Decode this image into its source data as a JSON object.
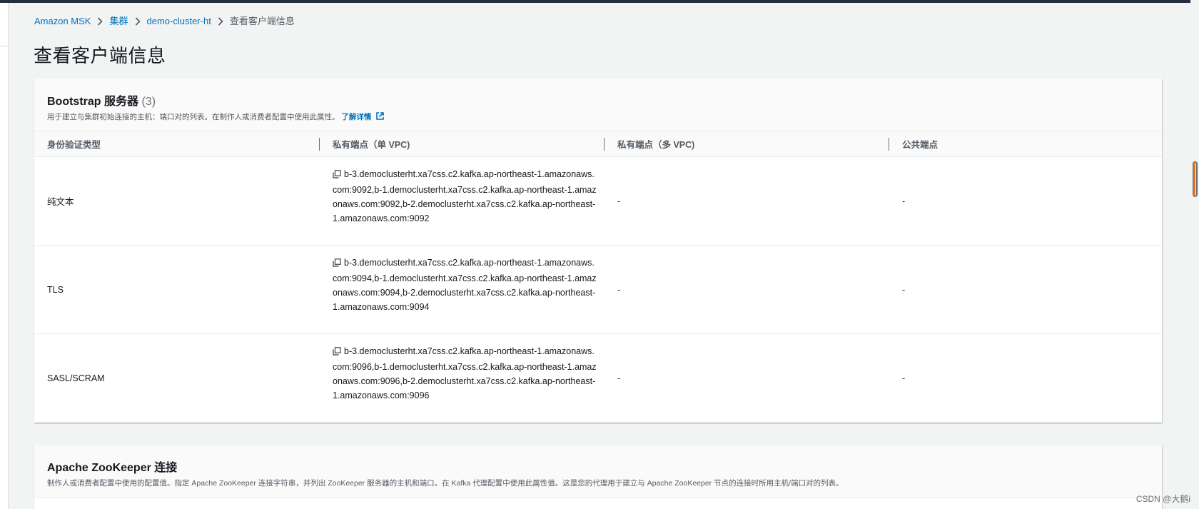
{
  "breadcrumb": {
    "items": [
      "Amazon MSK",
      "集群",
      "demo-cluster-ht"
    ],
    "current": "查看客户端信息"
  },
  "page_title": "查看客户端信息",
  "bootstrap": {
    "title": "Bootstrap 服务器",
    "count": "(3)",
    "description": "用于建立与集群初始连接的主机：端口对的列表。在制作人或消费者配置中使用此属性。",
    "learn_more": "了解详情",
    "columns": [
      "身份验证类型",
      "私有端点（单 VPC)",
      "私有端点（多 VPC)",
      "公共端点"
    ],
    "rows": [
      {
        "auth": "纯文本",
        "single_vpc": "b-3.democlusterht.xa7css.c2.kafka.ap-northeast-1.amazonaws.com:9092,b-1.democlusterht.xa7css.c2.kafka.ap-northeast-1.amazonaws.com:9092,b-2.democlusterht.xa7css.c2.kafka.ap-northeast-1.amazonaws.com:9092",
        "multi_vpc": "-",
        "public": "-"
      },
      {
        "auth": "TLS",
        "single_vpc": "b-3.democlusterht.xa7css.c2.kafka.ap-northeast-1.amazonaws.com:9094,b-1.democlusterht.xa7css.c2.kafka.ap-northeast-1.amazonaws.com:9094,b-2.democlusterht.xa7css.c2.kafka.ap-northeast-1.amazonaws.com:9094",
        "multi_vpc": "-",
        "public": "-"
      },
      {
        "auth": "SASL/SCRAM",
        "single_vpc": "b-3.democlusterht.xa7css.c2.kafka.ap-northeast-1.amazonaws.com:9096,b-1.democlusterht.xa7css.c2.kafka.ap-northeast-1.amazonaws.com:9096,b-2.democlusterht.xa7css.c2.kafka.ap-northeast-1.amazonaws.com:9096",
        "multi_vpc": "-",
        "public": "-"
      }
    ]
  },
  "zookeeper": {
    "title": "Apache ZooKeeper 连接",
    "description": "制作人或消费者配置中使用的配置值。指定 Apache ZooKeeper 连接字符串，并列出 ZooKeeper 服务器的主机和端口。在 Kafka 代理配置中使用此属性值。这是您的代理用于建立与 Apache ZooKeeper 节点的连接时所用主机/端口对的列表。"
  },
  "watermark": "CSDN @大鹅i",
  "colors": {
    "link": "#0073bb",
    "background": "#f2f3f3",
    "header_bar": "#232f3e",
    "scroll_accent": "#ec7211"
  },
  "icons": {
    "breadcrumb_separator": "chevron-right-icon",
    "copy": "copy-icon",
    "external_link": "external-link-icon"
  }
}
